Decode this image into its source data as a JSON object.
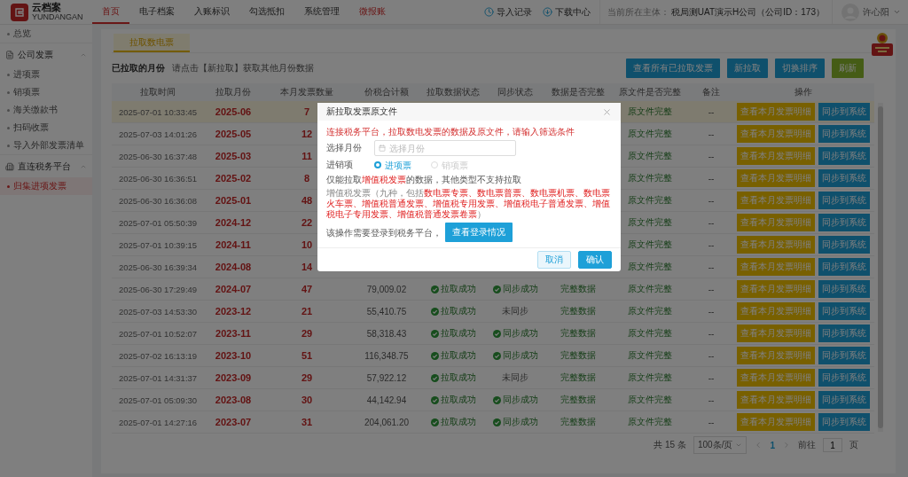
{
  "logo": {
    "name": "云档案",
    "subtitle": "YUNDANGAN"
  },
  "nav": [
    {
      "label": "首页",
      "selected": true,
      "kind": "normal"
    },
    {
      "label": "电子档案",
      "selected": false,
      "kind": "normal"
    },
    {
      "label": "入账标识",
      "selected": false,
      "kind": "normal"
    },
    {
      "label": "勾选抵扣",
      "selected": false,
      "kind": "normal"
    },
    {
      "label": "系统管理",
      "selected": false,
      "kind": "normal"
    },
    {
      "label": "微报账",
      "selected": false,
      "kind": "accent"
    }
  ],
  "header_links": [
    {
      "label": "导入记录",
      "kind": "history"
    },
    {
      "label": "下载中心",
      "kind": "download"
    }
  ],
  "entity": {
    "label": "当前所在主体：",
    "value": "税局测UAT演示H公司（公司ID：173）"
  },
  "user": {
    "name": "许心阳"
  },
  "sidebar": {
    "items": [
      {
        "label": "总览",
        "kind": "link",
        "selected": false
      },
      {
        "label": "公司发票",
        "kind": "group",
        "expanded": true,
        "children": [
          {
            "label": "进项票",
            "selected": false
          },
          {
            "label": "销项票",
            "selected": false
          },
          {
            "label": "海关缴款书",
            "selected": false
          },
          {
            "label": "扫码收票",
            "selected": false
          },
          {
            "label": "导入外部发票清单",
            "selected": false
          }
        ]
      },
      {
        "label": "直连税务平台",
        "kind": "group",
        "expanded": true,
        "children": [
          {
            "label": "归集进项发票",
            "selected": true
          }
        ]
      }
    ]
  },
  "tabs": [
    {
      "label": "拉取数电票",
      "selected": true
    }
  ],
  "toolbar": {
    "title": "已拉取的月份",
    "hint": "请点击【新拉取】获取其他月份数据",
    "buttons": [
      {
        "label": "查看所有已拉取发票",
        "kind": "primary"
      },
      {
        "label": "新拉取",
        "kind": "primary"
      },
      {
        "label": "切换排序",
        "kind": "primary"
      },
      {
        "label": "刷新",
        "kind": "success"
      }
    ]
  },
  "table": {
    "columns": [
      "拉取时间",
      "拉取月份",
      "本月发票数量",
      "价税合计额",
      "拉取数据状态",
      "同步状态",
      "数据是否完整",
      "原文件是否完整",
      "备注",
      "操作"
    ],
    "rows": [
      {
        "selected": true,
        "time": "2025-07-01 10:33:45",
        "month": "2025-06",
        "count": "7",
        "file_complete": "原文件完整",
        "remark": "--",
        "actions": [
          "查看本月发票明细",
          "同步到系统"
        ]
      },
      {
        "selected": false,
        "time": "2025-07-03 14:01:26",
        "month": "2025-05",
        "count": "12",
        "file_complete": "原文件完整",
        "remark": "--",
        "actions": [
          "查看本月发票明细",
          "同步到系统"
        ]
      },
      {
        "selected": false,
        "time": "2025-06-30 16:37:48",
        "month": "2025-03",
        "count": "11",
        "file_complete": "原文件完整",
        "remark": "--",
        "actions": [
          "查看本月发票明细",
          "同步到系统"
        ]
      },
      {
        "selected": false,
        "time": "2025-06-30 16:36:51",
        "month": "2025-02",
        "count": "8",
        "file_complete": "原文件完整",
        "remark": "--",
        "actions": [
          "查看本月发票明细",
          "同步到系统"
        ]
      },
      {
        "selected": false,
        "time": "2025-06-30 16:36:08",
        "month": "2025-01",
        "count": "48",
        "file_complete": "原文件完整",
        "remark": "--",
        "actions": [
          "查看本月发票明细",
          "同步到系统"
        ]
      },
      {
        "selected": false,
        "time": "2025-07-01 05:50:39",
        "month": "2024-12",
        "count": "22",
        "file_complete": "原文件完整",
        "remark": "--",
        "actions": [
          "查看本月发票明细",
          "同步到系统"
        ]
      },
      {
        "selected": false,
        "time": "2025-07-01 10:39:15",
        "month": "2024-11",
        "count": "10",
        "file_complete": "原文件完整",
        "remark": "--",
        "actions": [
          "查看本月发票明细",
          "同步到系统"
        ]
      },
      {
        "selected": false,
        "time": "2025-06-30 16:39:34",
        "month": "2024-08",
        "count": "14",
        "file_complete": "原文件完整",
        "remark": "--",
        "actions": [
          "查看本月发票明细",
          "同步到系统"
        ]
      },
      {
        "selected": false,
        "time": "2025-06-30 17:29:49",
        "month": "2024-07",
        "count": "47",
        "amount": "79,009.02",
        "pull_status": {
          "label": "拉取成功",
          "ok": true
        },
        "sync_status": {
          "label": "同步成功",
          "ok": true
        },
        "data_complete": "完整数据",
        "file_complete": "原文件完整",
        "remark": "--",
        "actions": [
          "查看本月发票明细",
          "同步到系统"
        ]
      },
      {
        "selected": false,
        "time": "2025-07-03 14:53:30",
        "month": "2023-12",
        "count": "21",
        "amount": "55,410.75",
        "pull_status": {
          "label": "拉取成功",
          "ok": true
        },
        "sync_status": {
          "label": "未同步",
          "ok": false
        },
        "data_complete": "完整数据",
        "file_complete": "原文件完整",
        "remark": "--",
        "actions": [
          "查看本月发票明细",
          "同步到系统"
        ]
      },
      {
        "selected": false,
        "time": "2025-07-01 10:52:07",
        "month": "2023-11",
        "count": "29",
        "amount": "58,318.43",
        "pull_status": {
          "label": "拉取成功",
          "ok": true
        },
        "sync_status": {
          "label": "同步成功",
          "ok": true
        },
        "data_complete": "完整数据",
        "file_complete": "原文件完整",
        "remark": "--",
        "actions": [
          "查看本月发票明细",
          "同步到系统"
        ]
      },
      {
        "selected": false,
        "time": "2025-07-02 16:13:19",
        "month": "2023-10",
        "count": "51",
        "amount": "116,348.75",
        "pull_status": {
          "label": "拉取成功",
          "ok": true
        },
        "sync_status": {
          "label": "同步成功",
          "ok": true
        },
        "data_complete": "完整数据",
        "file_complete": "原文件完整",
        "remark": "--",
        "actions": [
          "查看本月发票明细",
          "同步到系统"
        ]
      },
      {
        "selected": false,
        "time": "2025-07-01 14:31:37",
        "month": "2023-09",
        "count": "29",
        "amount": "57,922.12",
        "pull_status": {
          "label": "拉取成功",
          "ok": true
        },
        "sync_status": {
          "label": "未同步",
          "ok": false
        },
        "data_complete": "完整数据",
        "file_complete": "原文件完整",
        "remark": "--",
        "actions": [
          "查看本月发票明细",
          "同步到系统"
        ]
      },
      {
        "selected": false,
        "time": "2025-07-01 05:09:30",
        "month": "2023-08",
        "count": "30",
        "amount": "44,142.94",
        "pull_status": {
          "label": "拉取成功",
          "ok": true
        },
        "sync_status": {
          "label": "同步成功",
          "ok": true
        },
        "data_complete": "完整数据",
        "file_complete": "原文件完整",
        "remark": "--",
        "actions": [
          "查看本月发票明细",
          "同步到系统"
        ]
      },
      {
        "selected": false,
        "time": "2025-07-01 14:27:16",
        "month": "2023-07",
        "count": "31",
        "amount": "204,061.20",
        "pull_status": {
          "label": "拉取成功",
          "ok": true
        },
        "sync_status": {
          "label": "同步成功",
          "ok": true
        },
        "data_complete": "完整数据",
        "file_complete": "原文件完整",
        "remark": "--",
        "actions": [
          "查看本月发票明细",
          "同步到系统"
        ]
      }
    ]
  },
  "pagination": {
    "total": "共 15 条",
    "page_size": "100条/页",
    "pages": [
      {
        "label": "1",
        "selected": true
      }
    ],
    "goto_label": "前往",
    "goto_value": "1",
    "page_suffix": "页"
  },
  "dialog": {
    "title": "新拉取发票原文件",
    "message": "连接税务平台，拉取数电发票的数据及原文件，请输入筛选条件",
    "fields": [
      {
        "label": "选择月份",
        "kind": "date",
        "placeholder": "选择月份"
      },
      {
        "label": "进销项",
        "kind": "radio",
        "options": [
          {
            "label": "进项票",
            "selected": true,
            "disabled": false
          },
          {
            "label": "销项票",
            "selected": false,
            "disabled": true
          }
        ]
      }
    ],
    "note": "仅能拉取**增值税发票**的数据，其他类型不支持拉取",
    "detail": "增值税发票（九种，包括**数电票专票、数电票普票、数电票机票、数电票火车票、增值税普通发票、增值税专用发票、增值税电子普通发票、增值税电子专用发票、增值税普通发票卷票**）",
    "login": {
      "text": "该操作需要登录到税务平台，",
      "button": "查看登录情况"
    },
    "buttons": [
      {
        "label": "取消",
        "kind": "default"
      },
      {
        "label": "确认",
        "kind": "primary"
      }
    ]
  }
}
